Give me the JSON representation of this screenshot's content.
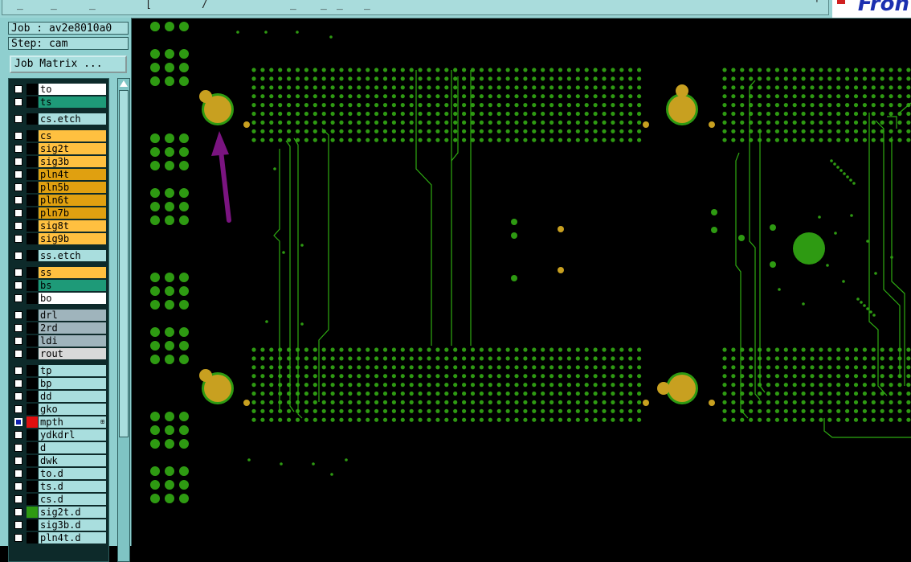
{
  "job": {
    "label": "Job : av2e8010a0",
    "step": "Step: cam"
  },
  "job_matrix_button": "Job Matrix ...",
  "colors": {
    "panel": "#8fcfcf",
    "via": "#c8a020",
    "pad": "#2e9a12",
    "trace": "#2eaa12",
    "arrow": "#7a1480"
  },
  "layers": [
    {
      "name": "to",
      "color": "#ffffff",
      "swatch": "#000000",
      "checked": false
    },
    {
      "name": "ts",
      "color": "#1e9a78",
      "swatch": "#000000",
      "checked": false
    },
    {
      "gap": true
    },
    {
      "name": "cs.etch",
      "color": "#a9dede",
      "swatch": "#000000",
      "checked": false
    },
    {
      "gap": true
    },
    {
      "name": "cs",
      "color": "#ffc040",
      "swatch": "#000000",
      "checked": false
    },
    {
      "name": "sig2t",
      "color": "#ffc040",
      "swatch": "#000000",
      "checked": false
    },
    {
      "name": "sig3b",
      "color": "#ffc040",
      "swatch": "#000000",
      "checked": false
    },
    {
      "name": "pln4t",
      "color": "#e0a010",
      "swatch": "#000000",
      "checked": false
    },
    {
      "name": "pln5b",
      "color": "#e0a010",
      "swatch": "#000000",
      "checked": false
    },
    {
      "name": "pln6t",
      "color": "#e0a010",
      "swatch": "#000000",
      "checked": false
    },
    {
      "name": "pln7b",
      "color": "#e0a010",
      "swatch": "#000000",
      "checked": false
    },
    {
      "name": "sig8t",
      "color": "#ffc040",
      "swatch": "#000000",
      "checked": false
    },
    {
      "name": "sig9b",
      "color": "#ffc040",
      "swatch": "#000000",
      "checked": false
    },
    {
      "gap": true
    },
    {
      "name": "ss.etch",
      "color": "#a9dede",
      "swatch": "#000000",
      "checked": false
    },
    {
      "gap": true
    },
    {
      "name": "ss",
      "color": "#ffc040",
      "swatch": "#000000",
      "checked": false
    },
    {
      "name": "bs",
      "color": "#1e9a78",
      "swatch": "#000000",
      "checked": false
    },
    {
      "name": "bo",
      "color": "#ffffff",
      "swatch": "#000000",
      "checked": false
    },
    {
      "gap": true
    },
    {
      "name": "drl",
      "color": "#9fb4bc",
      "swatch": "#000000",
      "checked": false
    },
    {
      "name": "2rd",
      "color": "#9fb4bc",
      "swatch": "#000000",
      "checked": false
    },
    {
      "name": "ldi",
      "color": "#9fb4bc",
      "swatch": "#000000",
      "checked": false
    },
    {
      "name": "rout",
      "color": "#d8d8d8",
      "swatch": "#000000",
      "checked": false
    },
    {
      "gap": true
    },
    {
      "name": "tp",
      "color": "#a9dede",
      "swatch": "#000000",
      "checked": false
    },
    {
      "name": "bp",
      "color": "#a9dede",
      "swatch": "#000000",
      "checked": false
    },
    {
      "name": "dd",
      "color": "#a9dede",
      "swatch": "#000000",
      "checked": false
    },
    {
      "name": "gko",
      "color": "#a9dede",
      "swatch": "#000000",
      "checked": false
    },
    {
      "name": "mpth",
      "color": "#a9dede",
      "swatch": "#e01010",
      "checked": true,
      "marker": "⊞"
    },
    {
      "name": "ydkdrl",
      "color": "#a9dede",
      "swatch": "#000000",
      "checked": false
    },
    {
      "name": "d",
      "color": "#a9dede",
      "swatch": "#000000",
      "checked": false
    },
    {
      "name": "dwk",
      "color": "#a9dede",
      "swatch": "#000000",
      "checked": false
    },
    {
      "name": "to.d",
      "color": "#a9dede",
      "swatch": "#000000",
      "checked": false
    },
    {
      "name": "ts.d",
      "color": "#a9dede",
      "swatch": "#000000",
      "checked": false
    },
    {
      "name": "cs.d",
      "color": "#a9dede",
      "swatch": "#000000",
      "checked": false
    },
    {
      "name": "sig2t.d",
      "color": "#a9dede",
      "swatch": "#2e9a12",
      "checked": false
    },
    {
      "name": "sig3b.d",
      "color": "#a9dede",
      "swatch": "#000000",
      "checked": false
    },
    {
      "name": "pln4t.d",
      "color": "#a9dede",
      "swatch": "#000000",
      "checked": false
    }
  ]
}
